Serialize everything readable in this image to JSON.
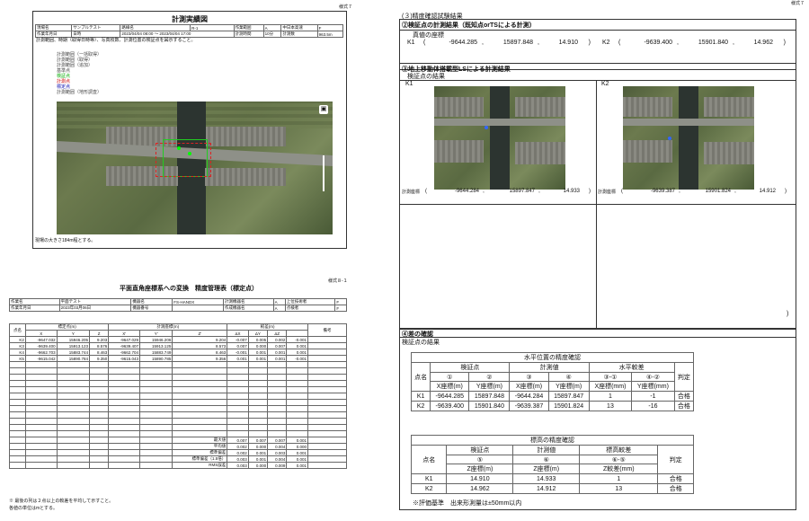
{
  "left_top": {
    "form_no": "様式７",
    "title": "計測実績図",
    "info_row1": [
      "現場名",
      "サンプルテスト",
      "路線名",
      "R-1",
      "作業範囲",
      "A",
      "中日本高速",
      "F"
    ],
    "info_row2": [
      "作業年月日",
      "日時",
      "2023/04/04 08:00 ～ 2023/04/04 17:00",
      "計測時間",
      "10分",
      "計測数",
      "963.5m"
    ],
    "note_line": "計測範囲、時期（取得日時等）、写真枚数、計測位置の検証点を図示すること。",
    "legend": [
      "計測範囲（一括取得）",
      "計測範囲（取得）",
      "計測範囲（追加）",
      "基準点",
      "検証点",
      "計測点",
      "標定点",
      "計測範囲（地形調査）"
    ],
    "footer": "現場の大きさ184m程とする。"
  },
  "left_bottom": {
    "form_no": "様式８-１",
    "title": "平面直角座標系への変換　精度管理表（標定点）",
    "info": [
      [
        "作業名",
        "平面テスト",
        "機器名",
        "FS-HANDX",
        "計測機器名",
        "A",
        "上位技術者",
        "F"
      ],
      [
        "作業年月日",
        "2023年03月06日",
        "機器番号",
        "",
        "作成機器名",
        "A",
        "点検者",
        "F"
      ]
    ],
    "grp_headers": [
      "標定点(m)",
      "計測座標(m)",
      "較差(m)"
    ],
    "col_headers": [
      "点名",
      "X",
      "Y",
      "Z",
      "X'",
      "Y'",
      "Z'",
      "ΔX",
      "ΔY",
      "ΔZ",
      "備考"
    ],
    "rows": [
      [
        "K2",
        "-9647.032",
        "15946.205",
        "9.203",
        "-9647.029",
        "15946.206",
        "9.204",
        "-0.007",
        "0.005",
        "0.002",
        "-0.001"
      ],
      [
        "K3",
        "-9639.400",
        "15913.123",
        "8.576",
        "-9639.407",
        "15913.125",
        "8.573",
        "0.007",
        "0.000",
        "0.007",
        "0.001"
      ],
      [
        "K4",
        "-9662.703",
        "15883.744",
        "8.463",
        "-9662.704",
        "15883.749",
        "8.463",
        "-0.001",
        "0.001",
        "0.001",
        "0.001"
      ],
      [
        "K5",
        "-9615.042",
        "15890.784",
        "9.350",
        "-9615.043",
        "15890.785",
        "9.356",
        "0.001",
        "0.001",
        "0.001",
        "-0.001"
      ]
    ],
    "stats": [
      [
        "最大値",
        "0.007",
        "0.007",
        "0.007",
        "0.001"
      ],
      [
        "平均値",
        "0.002",
        "0.000",
        "0.004",
        "0.000"
      ],
      [
        "標準偏差",
        "0.002",
        "0.001",
        "0.003",
        "0.001"
      ],
      [
        "標準偏差（1.5倍）",
        "0.003",
        "0.001",
        "0.004",
        "0.001"
      ],
      [
        "RMS誤差",
        "0.003",
        "0.000",
        "0.009",
        "0.001"
      ]
    ],
    "notes": [
      "※ 最後の列は２点以上の較差を平均して示すこと。",
      "各値の単位はmとする。"
    ]
  },
  "right": {
    "form_no": "様式７",
    "s3_title": "(３)精度確認試験結果",
    "s2_title": "②検証点の計測結果（既知点orTSによる計測）",
    "true_label": "真値の座標",
    "k1": {
      "name": "K1",
      "x": "-9644.285",
      "y": "15897.848",
      "z": "14.910"
    },
    "k2": {
      "name": "K2",
      "x": "-9639.400",
      "y": "15901.840",
      "z": "14.962"
    },
    "s4_title": "③地上移動体搭載型LSによる計測結果",
    "check_label": "検証点の結果",
    "meas_label": "計測座標",
    "m1": {
      "name": "K1",
      "x": "-9644.284",
      "y": "15897.847",
      "z": "14.933"
    },
    "m2": {
      "name": "K2",
      "x": "-9639.387",
      "y": "15901.824",
      "z": "14.912"
    },
    "s5_title": "④差の確認",
    "s5_sub": "検証点の結果",
    "h_title": "水平位置の精度確認",
    "h_headers": [
      "点名",
      "検証点",
      "計測値",
      "水平較差",
      "判定"
    ],
    "h_sub": [
      "①",
      "②",
      "③",
      "④",
      "③-①",
      "④-②"
    ],
    "h_units": [
      "X座標(m)",
      "Y座標(m)",
      "X座標(m)",
      "Y座標(m)",
      "X座標(mm)",
      "Y座標(mm)"
    ],
    "h_rows": [
      [
        "K1",
        "-9644.285",
        "15897.848",
        "-9644.284",
        "15897.847",
        "1",
        "-1",
        "合格"
      ],
      [
        "K2",
        "-9639.400",
        "15901.840",
        "-9639.387",
        "15901.824",
        "13",
        "-16",
        "合格"
      ]
    ],
    "v_title": "標高の精度確認",
    "v_headers": [
      "点名",
      "検証点",
      "計測値",
      "標高較差",
      "判定"
    ],
    "v_sub": [
      "⑤",
      "⑥",
      "⑥-⑤"
    ],
    "v_units": [
      "Z座標(m)",
      "Z座標(m)",
      "Z較差(mm)"
    ],
    "v_rows": [
      [
        "K1",
        "14.910",
        "14.933",
        "1",
        "合格"
      ],
      [
        "K2",
        "14.962",
        "14.912",
        "13",
        "合格"
      ]
    ],
    "criteria": "※評価基準　出来形測量は±50mm以内"
  }
}
